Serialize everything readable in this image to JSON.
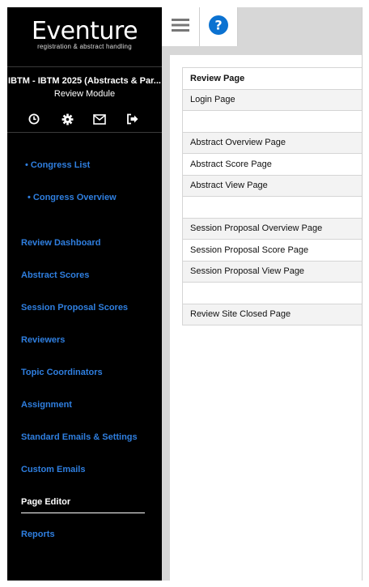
{
  "brand": {
    "title": "Eventure",
    "subtitle": "registration & abstract handling"
  },
  "sidebar": {
    "event_name": "IBTM - IBTM 2025 (Abstracts & Par...",
    "module_name": "Review Module",
    "icons": [
      "clock-icon",
      "gear-icon",
      "envelope-icon",
      "logout-icon"
    ],
    "sub_links": [
      {
        "label": "• Congress List"
      },
      {
        "label": "• Congress Overview"
      }
    ],
    "items": [
      {
        "label": "Review Dashboard"
      },
      {
        "label": "Abstract Scores"
      },
      {
        "label": "Session Proposal Scores"
      },
      {
        "label": "Reviewers"
      },
      {
        "label": "Topic Coordinators"
      },
      {
        "label": "Assignment"
      },
      {
        "label": "Standard Emails & Settings"
      },
      {
        "label": "Custom Emails"
      },
      {
        "label": "Page Editor",
        "active": true
      },
      {
        "label": "Reports"
      }
    ]
  },
  "topbar": {
    "buttons": [
      "hamburger-menu-icon",
      "help-icon"
    ]
  },
  "pages": {
    "rows": [
      {
        "label": "Review Page"
      },
      {
        "label": "Login Page"
      },
      {
        "label": ""
      },
      {
        "label": "Abstract Overview Page"
      },
      {
        "label": "Abstract Score Page"
      },
      {
        "label": "Abstract View Page"
      },
      {
        "label": ""
      },
      {
        "label": "Session Proposal Overview Page"
      },
      {
        "label": "Session Proposal Score Page"
      },
      {
        "label": "Session Proposal View Page"
      },
      {
        "label": ""
      },
      {
        "label": "Review Site Closed Page"
      }
    ]
  },
  "colors": {
    "sidebar_bg": "#000000",
    "link": "#2f7fe0",
    "help_blue": "#0b72d1",
    "topbar_bg": "#d7d7d7"
  }
}
